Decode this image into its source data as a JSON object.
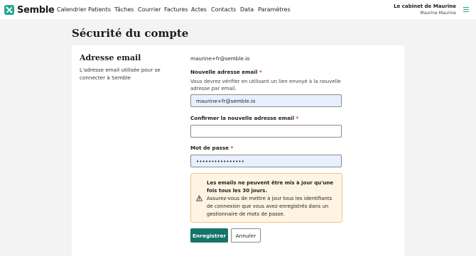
{
  "brand": {
    "name": "Semble",
    "accent": "#20a98e"
  },
  "nav": {
    "items": [
      "Calendrier",
      "Patients",
      "Tâches",
      "Courrier",
      "Factures",
      "Actes",
      "Contacts",
      "Data",
      "Paramètres"
    ]
  },
  "org": {
    "name": "Le cabinet de Maurine",
    "user": "Maurine Maurine"
  },
  "page": {
    "title": "Sécurité du compte"
  },
  "email_section": {
    "title": "Adresse email",
    "description": "L'adresse email utilisée pour se connecter à Semble",
    "current_email": "maurine+fr@semble.io",
    "new_email_label": "Nouvelle adresse email",
    "new_email_help": "Vous devrez vérifier en utilisant un lien envoyé à la nouvelle adresse par email.",
    "new_email_value": "maurine+fr@semble.io",
    "confirm_label": "Confirmer la nouvelle adresse email",
    "confirm_value": "",
    "password_label": "Mot de passe",
    "password_value": "••••••••••••••••",
    "required_marker": "*"
  },
  "warning": {
    "icon": "warning-triangle-icon",
    "title": "Les emails ne peuvent être mis à jour qu'une fois tous les 30 jours.",
    "body": "Assurez-vous de mettre à jour tous les identifiants de connexion que vous avez enregistrés dans un gestionnaire de mots de passe."
  },
  "actions": {
    "save": "Enregistrer",
    "cancel": "Annuler"
  },
  "colors": {
    "primary_button": "#14736a",
    "warning_bg": "#fff4e3",
    "warning_border": "#f2c185",
    "required": "#d6293d",
    "autofill": "#e8f0fe"
  }
}
